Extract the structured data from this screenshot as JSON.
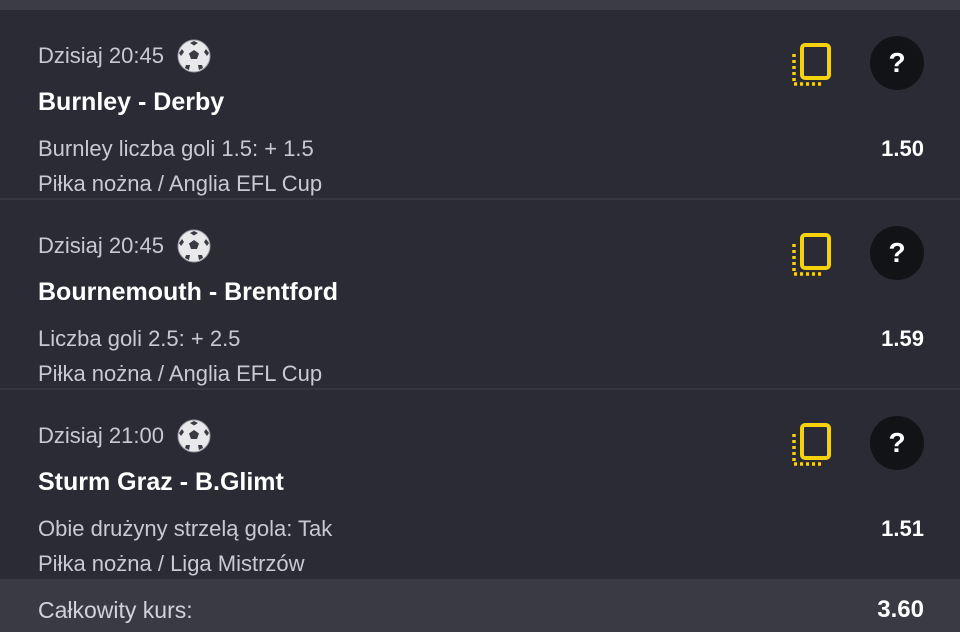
{
  "bets": [
    {
      "datetime": "Dzisiaj 20:45",
      "sport_icon": "soccer-ball-icon",
      "teams": "Burnley - Derby",
      "market": "Burnley liczba goli 1.5: + 1.5",
      "league": "Piłka nożna / Anglia EFL Cup",
      "odds": "1.50",
      "help_label": "?"
    },
    {
      "datetime": "Dzisiaj 20:45",
      "sport_icon": "soccer-ball-icon",
      "teams": "Bournemouth - Brentford",
      "market": "Liczba goli 2.5: + 2.5",
      "league": "Piłka nożna / Anglia EFL Cup",
      "odds": "1.59",
      "help_label": "?"
    },
    {
      "datetime": "Dzisiaj 21:00",
      "sport_icon": "soccer-ball-icon",
      "teams": "Sturm Graz - B.Glimt",
      "market": "Obie drużyny strzelą gola: Tak",
      "league": "Piłka nożna / Liga Mistrzów",
      "odds": "1.51",
      "help_label": "?"
    }
  ],
  "footer": {
    "total_label": "Całkowity kurs:",
    "total_odds": "3.60"
  },
  "colors": {
    "background": "#2a2b35",
    "accent_yellow": "#f5d20c",
    "footer_bg": "#393a44",
    "help_bg": "#121317"
  }
}
